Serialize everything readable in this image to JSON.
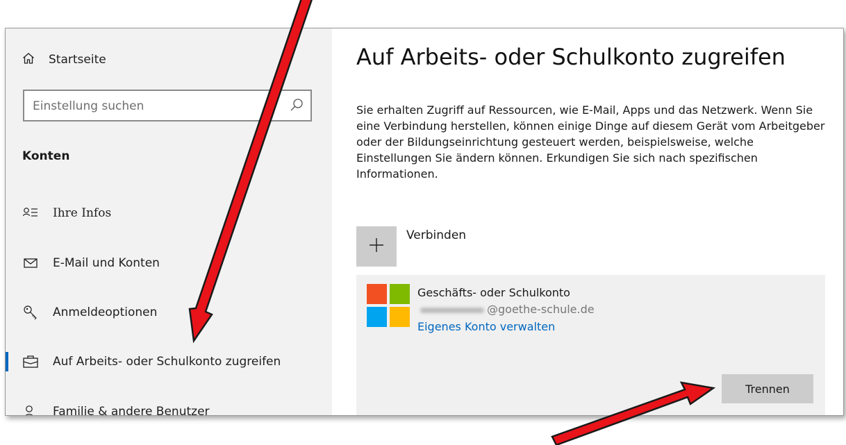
{
  "sidebar": {
    "home": {
      "label": "Startseite",
      "icon": "home-icon"
    },
    "search": {
      "placeholder": "Einstellung suchen",
      "icon": "search-icon"
    },
    "section_title": "Konten",
    "items": [
      {
        "label": "Ihre Infos",
        "icon": "person-info-icon"
      },
      {
        "label": "E-Mail und Konten",
        "icon": "mail-icon"
      },
      {
        "label": "Anmeldeoptionen",
        "icon": "key-icon"
      },
      {
        "label": "Auf Arbeits- oder Schulkonto zugreifen",
        "icon": "briefcase-icon",
        "active": true
      },
      {
        "label": "Familie & andere Benutzer",
        "icon": "person-icon"
      }
    ]
  },
  "main": {
    "title": "Auf Arbeits- oder Schulkonto zugreifen",
    "description": "Sie erhalten Zugriff auf Ressourcen, wie E-Mail, Apps und das Netzwerk. Wenn Sie eine Verbindung herstellen, können einige Dinge auf diesem Gerät vom Arbeitgeber oder der Bildungseinrichtung gesteuert werden, beispielsweise, welche Einstellungen Sie ändern können. Erkundigen Sie sich nach spezifischen Informationen.",
    "connect": {
      "label": "Verbinden",
      "icon": "plus-icon"
    },
    "account": {
      "type": "Geschäfts- oder Schulkonto",
      "email_domain": "@goethe-schule.de",
      "manage_link": "Eigenes Konto verwalten",
      "disconnect_label": "Trennen",
      "logo": "microsoft-logo"
    }
  },
  "colors": {
    "accent": "#0067c0",
    "arrow": "#e8141a",
    "ms_red": "#f25022",
    "ms_green": "#7fba00",
    "ms_blue": "#00a4ef",
    "ms_yellow": "#ffb900"
  }
}
